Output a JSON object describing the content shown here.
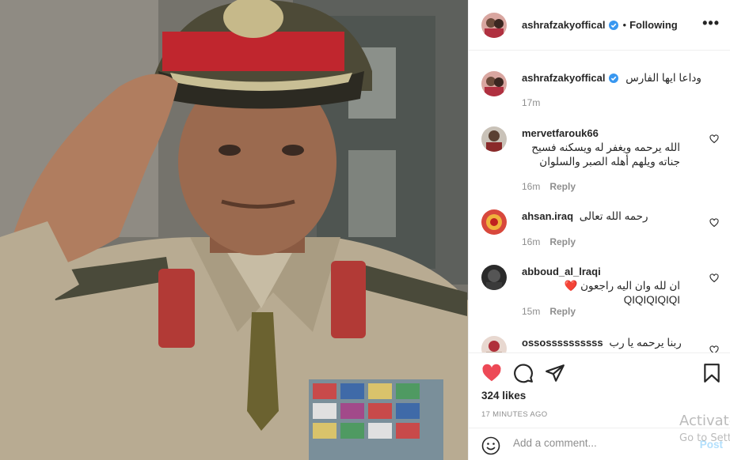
{
  "post": {
    "image_alt_icon": "military-portrait-photo"
  },
  "header": {
    "username": "ashrafzakyoffical",
    "verified_icon": "verified-badge-icon",
    "separator": "•",
    "follow_status": "Following",
    "more_label": "•••"
  },
  "caption": {
    "username": "ashrafzakyoffical",
    "text": "وداعا ايها الفارس",
    "time": "17m"
  },
  "comments": [
    {
      "username": "mervetfarouk66",
      "text": "الله يرحمه ويغفر له ويسكنه فسيح جناته ويلهم أهله الصبر والسلوان",
      "time": "16m",
      "reply_label": "Reply"
    },
    {
      "username": "ahsan.iraq",
      "text": "رحمه الله تعالى",
      "time": "16m",
      "reply_label": "Reply"
    },
    {
      "username": "abboud_al_lraqi",
      "text": "ان لله وان اليه راجعون ❤️ QIQIQIQIQI",
      "time": "15m",
      "reply_label": "Reply"
    },
    {
      "username": "ossossssssssss",
      "text": "ربنا يرحمه يا رب"
    }
  ],
  "actions": {
    "like_icon": "heart-filled-icon",
    "comment_icon": "comment-bubble-icon",
    "share_icon": "paper-plane-icon",
    "save_icon": "bookmark-icon",
    "like_color": "#ed4956"
  },
  "likes_text": "324 likes",
  "timestamp": "17 MINUTES AGO",
  "composer": {
    "emoji_icon": "smiley-icon",
    "placeholder": "Add a comment...",
    "post_label": "Post"
  },
  "watermark": {
    "line1": "Activate",
    "line2": "Go to Sett"
  }
}
